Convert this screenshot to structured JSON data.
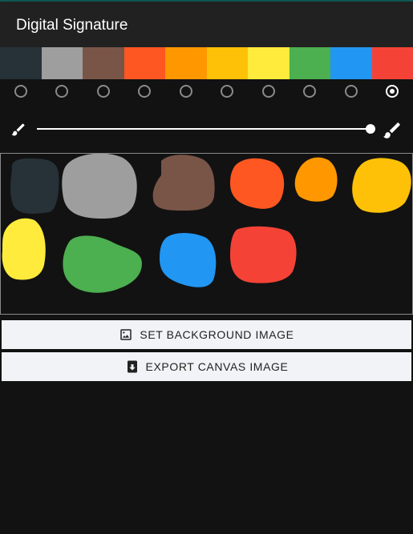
{
  "app": {
    "title": "Digital Signature"
  },
  "palette": {
    "colors": [
      "#263238",
      "#9e9e9e",
      "#795548",
      "#ff5722",
      "#ff9800",
      "#ffc107",
      "#ffeb3b",
      "#4caf50",
      "#2196f3",
      "#f44336"
    ],
    "selected_index": 9
  },
  "brush": {
    "small_icon": "brush-small-icon",
    "large_icon": "brush-large-icon",
    "size_level": 1.0
  },
  "canvas": {
    "strokes": [
      {
        "color": "#263238"
      },
      {
        "color": "#9e9e9e"
      },
      {
        "color": "#795548"
      },
      {
        "color": "#ff5722"
      },
      {
        "color": "#ff9800"
      },
      {
        "color": "#ffc107"
      },
      {
        "color": "#ffeb3b"
      },
      {
        "color": "#4caf50"
      },
      {
        "color": "#2196f3"
      },
      {
        "color": "#f44336"
      }
    ]
  },
  "actions": {
    "set_background_label": "SET BACKGROUND IMAGE",
    "set_background_icon": "image-icon",
    "export_label": "EXPORT CANVAS IMAGE",
    "export_icon": "download-icon"
  }
}
